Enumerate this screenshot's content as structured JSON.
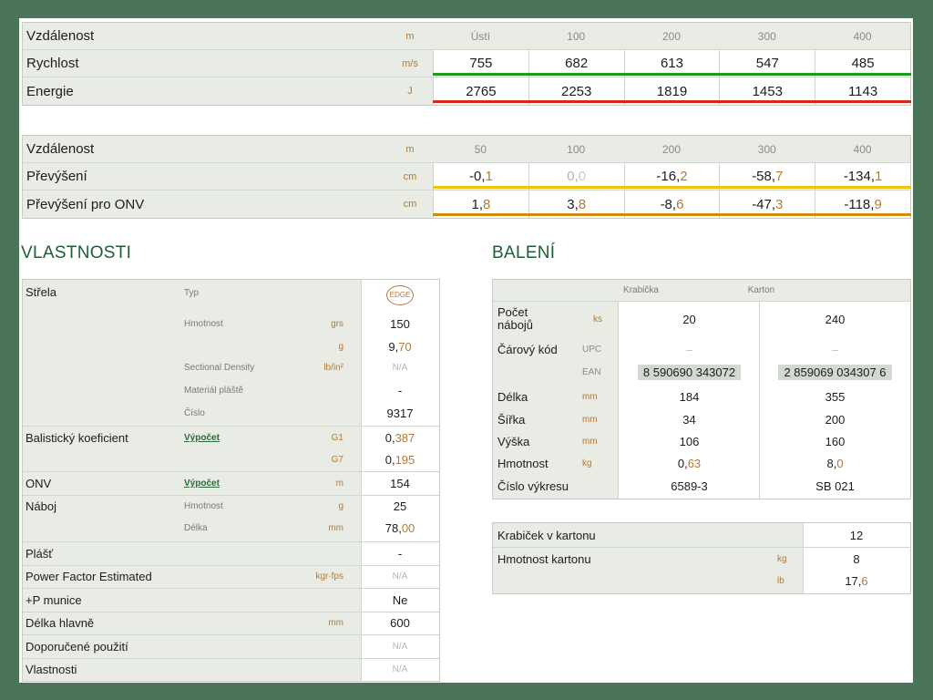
{
  "colors": {
    "frame": "#4b7559",
    "section_title": "#1f5e35",
    "velocity_bar": "#1e9a1e",
    "energy_bar": "#d8261c",
    "drop_bar": "#f0c20e",
    "onv_bar": "#d68a0a",
    "unit": "#b07a3a"
  },
  "ballistics": {
    "distance_label": "Vzdálenost",
    "distance_unit": "m",
    "distances": [
      "Ústí",
      "100",
      "200",
      "300",
      "400"
    ],
    "velocity_label": "Rychlost",
    "velocity_unit": "m/s",
    "velocity": [
      "755",
      "682",
      "613",
      "547",
      "485"
    ],
    "energy_label": "Energie",
    "energy_unit": "J",
    "energy": [
      "2765",
      "2253",
      "1819",
      "1453",
      "1143"
    ]
  },
  "trajectory": {
    "distance_label": "Vzdálenost",
    "distance_unit": "m",
    "distances": [
      "50",
      "100",
      "200",
      "300",
      "400"
    ],
    "drop_label": "Převýšení",
    "drop_unit": "cm",
    "drop": [
      [
        "-0",
        "1"
      ],
      [
        "0",
        "0"
      ],
      [
        "-16",
        "2"
      ],
      [
        "-58",
        "7"
      ],
      [
        "-134",
        "1"
      ]
    ],
    "drop_onv_label": "Převýšení pro ONV",
    "drop_onv_unit": "cm",
    "drop_onv": [
      [
        "1",
        "8"
      ],
      [
        "3",
        "8"
      ],
      [
        "-8",
        "6"
      ],
      [
        "-47",
        "3"
      ],
      [
        "-118",
        "9"
      ]
    ]
  },
  "properties": {
    "title": "VLASTNOSTI",
    "bullet_label": "Střela",
    "type_label": "Typ",
    "type_badge": "EDGE",
    "weight_label": "Hmotnost",
    "weight_grs_unit": "grs",
    "weight_grs": "150",
    "weight_g_unit": "g",
    "weight_g": [
      "9",
      "70"
    ],
    "sd_label": "Sectional Density",
    "sd_unit": "lb/in²",
    "sd_value": "N/A",
    "jacket_label": "Materiál pláště",
    "jacket_value": "-",
    "number_label": "Číslo",
    "number_value": "9317",
    "bc_label": "Balistický koeficient",
    "bc_link": "Výpočet",
    "g1_label": "G1",
    "g1_value": [
      "0",
      "387"
    ],
    "g7_label": "G7",
    "g7_value": [
      "0",
      "195"
    ],
    "onv_label": "ONV",
    "onv_link": "Výpočet",
    "onv_unit": "m",
    "onv_value": "154",
    "cartridge_label": "Náboj",
    "cartridge_weight_label": "Hmotnost",
    "cartridge_weight_unit": "g",
    "cartridge_weight": "25",
    "cartridge_length_label": "Délka",
    "cartridge_length_unit": "mm",
    "cartridge_length": [
      "78",
      "00"
    ],
    "case_label": "Plášť",
    "case_value": "-",
    "pf_label": "Power Factor Estimated",
    "pf_unit": "kgr·fps",
    "pf_value": "N/A",
    "plusp_label": "+P munice",
    "plusp_value": "Ne",
    "barrel_label": "Délka hlavně",
    "barrel_unit": "mm",
    "barrel_value": "600",
    "usage_label": "Doporučené použití",
    "usage_value": "N/A",
    "features_label": "Vlastnosti",
    "features_value": "N/A"
  },
  "packaging": {
    "title": "BALENÍ",
    "col_box": "Krabička",
    "col_carton": "Karton",
    "count_label": "Počet nábojů",
    "count_unit": "ks",
    "count_box": "20",
    "count_carton": "240",
    "barcode_label": "Čárový kód",
    "upc_label": "UPC",
    "upc_box": "–",
    "upc_carton": "–",
    "ean_label": "EAN",
    "ean_box": "8 590690 343072",
    "ean_carton": "2 859069 034307 6",
    "length_label": "Délka",
    "length_unit": "mm",
    "length_box": "184",
    "length_carton": "355",
    "width_label": "Šířka",
    "width_unit": "mm",
    "width_box": "34",
    "width_carton": "200",
    "height_label": "Výška",
    "height_unit": "mm",
    "height_box": "106",
    "height_carton": "160",
    "weight_label": "Hmotnost",
    "weight_unit": "kg",
    "weight_box": [
      "0",
      "63"
    ],
    "weight_carton": [
      "8",
      "0"
    ],
    "drawing_label": "Číslo výkresu",
    "drawing_box": "6589-3",
    "drawing_carton": "SB 021"
  },
  "carton": {
    "boxes_label": "Krabiček v kartonu",
    "boxes_value": "12",
    "weight_label": "Hmotnost kartonu",
    "weight_kg_unit": "kg",
    "weight_kg": "8",
    "weight_lb_unit": "lb",
    "weight_lb": [
      "17",
      "6"
    ]
  }
}
